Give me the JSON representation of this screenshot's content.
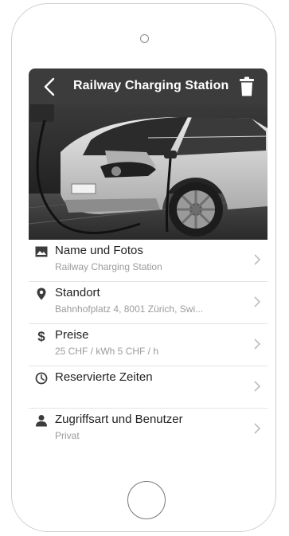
{
  "header": {
    "title": "Railway Charging Station"
  },
  "hero": {
    "image": "electric car charging photo"
  },
  "rows": [
    {
      "label": "Name und Fotos",
      "sub": "Railway Charging Station",
      "icon": "image-icon"
    },
    {
      "label": "Standort",
      "sub": "Bahnhofplatz 4, 8001 Zürich, Swi...",
      "icon": "map-pin-icon"
    },
    {
      "label": "Preise",
      "sub": "25 CHF / kWh  5 CHF / h",
      "icon": "dollar-icon"
    },
    {
      "label": "Reservierte Zeiten",
      "sub": "",
      "icon": "clock-icon"
    },
    {
      "label": "Zugriffsart und Benutzer",
      "sub": "Privat",
      "icon": "user-icon"
    }
  ],
  "colors": {
    "header_bg": "#3c3c3c",
    "label": "#222222",
    "sub": "#9b9b9b",
    "divider": "#e4e4e4"
  }
}
